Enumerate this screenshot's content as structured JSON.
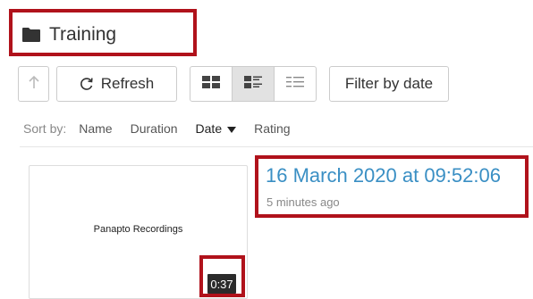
{
  "header": {
    "folder_name": "Training"
  },
  "toolbar": {
    "refresh_label": "Refresh",
    "filter_label": "Filter by date",
    "views": [
      "thumbnail-view",
      "detail-view",
      "list-view"
    ],
    "active_view": "detail-view"
  },
  "sort": {
    "label": "Sort by:",
    "options": [
      "Name",
      "Duration",
      "Date",
      "Rating"
    ],
    "active": "Date",
    "direction": "descending"
  },
  "session": {
    "thumbnail_text": "Panapto Recordings",
    "duration": "0:37",
    "title": "16 March 2020 at 09:52:06",
    "relative_time": "5 minutes ago"
  },
  "colors": {
    "highlight": "#b0121b",
    "link": "#3a8fc4"
  }
}
